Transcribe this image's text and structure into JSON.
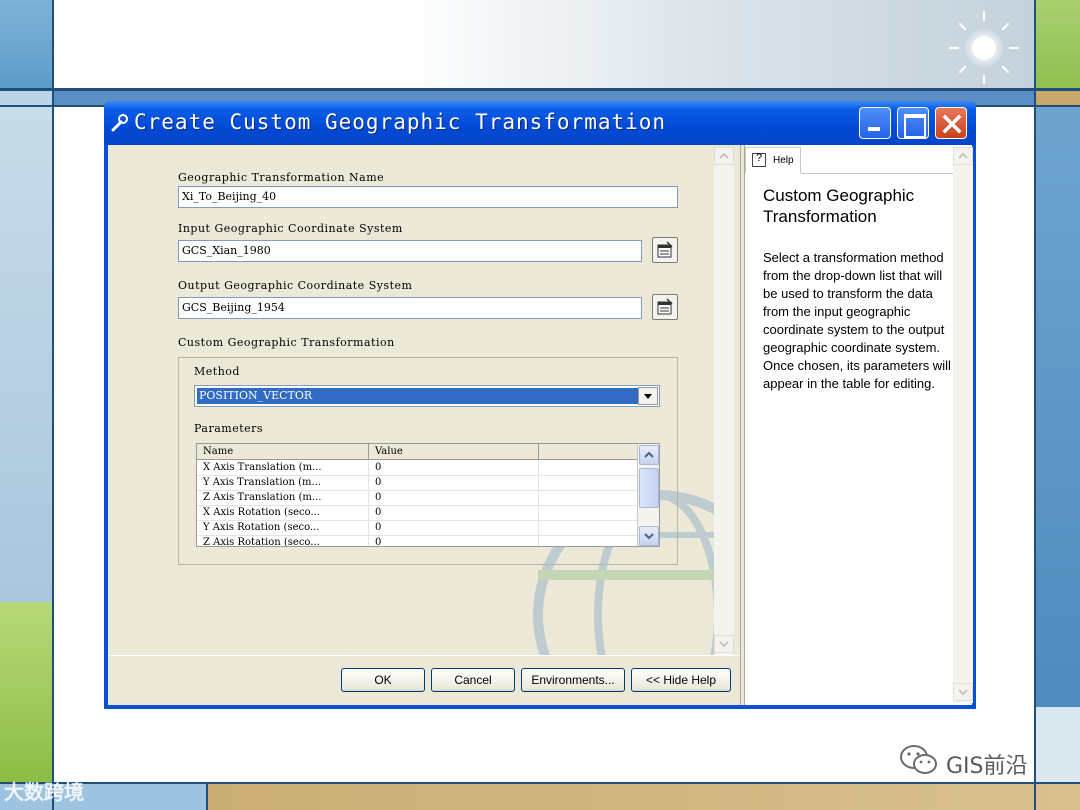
{
  "dialog": {
    "title": "Create Custom Geographic Transformation",
    "icon": "wrench-icon"
  },
  "form": {
    "transformation_name_label": "Geographic Transformation Name",
    "transformation_name_value": "Xi_To_Beijing_40",
    "input_gcs_label": "Input Geographic Coordinate System",
    "input_gcs_value": "GCS_Xian_1980",
    "output_gcs_label": "Output Geographic Coordinate System",
    "output_gcs_value": "GCS_Beijing_1954",
    "custom_section_label": "Custom Geographic Transformation",
    "method_label": "Method",
    "method_value": "POSITION_VECTOR",
    "parameters_label": "Parameters",
    "parameters_columns": [
      "Name",
      "Value"
    ],
    "parameters_rows": [
      {
        "name": "X Axis Translation (m...",
        "value": "0"
      },
      {
        "name": "Y Axis Translation (m...",
        "value": "0"
      },
      {
        "name": "Z Axis Translation (m...",
        "value": "0"
      },
      {
        "name": "X Axis Rotation (seco...",
        "value": "0"
      },
      {
        "name": "Y Axis Rotation (seco...",
        "value": "0"
      },
      {
        "name": "Z Axis Rotation (seco...",
        "value": "0"
      }
    ]
  },
  "buttons": {
    "ok": "OK",
    "cancel": "Cancel",
    "environments": "Environments...",
    "hide_help": "<< Hide Help"
  },
  "help": {
    "tab_label": "Help",
    "title": "Custom Geographic Transformation",
    "body": "Select a transformation method from the drop-down list that will be used to transform the data from the input geographic coordinate system to the output geographic coordinate system. Once chosen, its parameters will appear in the table for editing."
  },
  "watermarks": {
    "left": "大数跨境",
    "right": "GIS前沿"
  },
  "colors": {
    "titlebar": "#0349d6",
    "selection": "#316ac5",
    "dialog_face": "#ece9d8"
  }
}
